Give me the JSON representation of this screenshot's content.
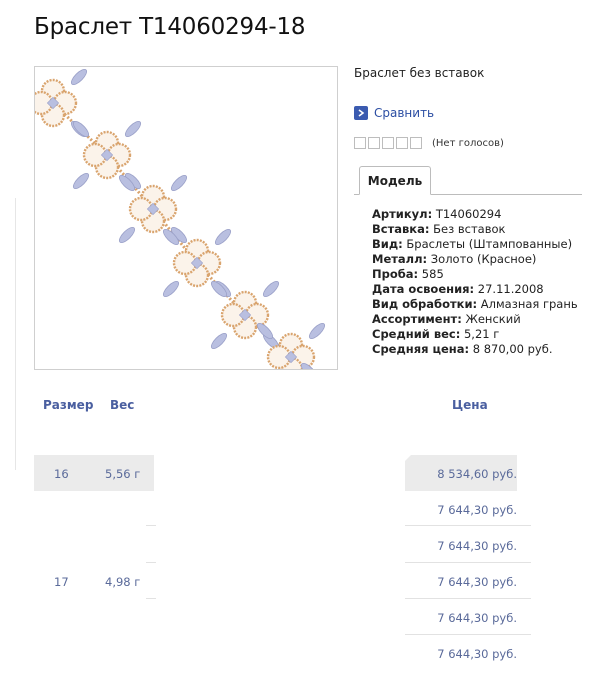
{
  "product": {
    "title": "Браслет Т14060294-18",
    "subtitle": "Браслет без вставок",
    "compare_label": "Сравнить",
    "votes_label": "(Нет голосов)",
    "rating_value": 0,
    "rating_max": 5,
    "tab_model_label": "Модель"
  },
  "specs": [
    {
      "label": "Артикул:",
      "value": " Т14060294"
    },
    {
      "label": "Вставка:",
      "value": " Без вставок"
    },
    {
      "label": "Вид:",
      "value": " Браслеты (Штампованные)"
    },
    {
      "label": "Металл:",
      "value": " Золото (Красное)"
    },
    {
      "label": "Проба:",
      "value": " 585"
    },
    {
      "label": "Дата освоения:",
      "value": " 27.11.2008"
    },
    {
      "label": "Вид обработки:",
      "value": " Алмазная грань"
    },
    {
      "label": "Ассортимент:",
      "value": " Женский"
    },
    {
      "label": "Средний вес:",
      "value": " 5,21 г"
    },
    {
      "label": "Средняя цена:",
      "value": " 8 870,00 руб."
    }
  ],
  "table": {
    "headers": {
      "size": "Размер",
      "weight": "Вес",
      "price": "Цена"
    },
    "groups": [
      {
        "size": "16",
        "weight": "5,56 г"
      },
      {
        "size": "17",
        "weight": "4,98 г"
      }
    ],
    "prices": [
      "8 534,60 руб.",
      "7 644,30 руб.",
      "7 644,30 руб.",
      "7 644,30 руб.",
      "7 644,30 руб.",
      "7 644,30 руб."
    ]
  },
  "colors": {
    "accent": "#2c4ea3",
    "header_text": "#4a5fa0",
    "cell_text": "#5a6a9a",
    "highlight_row": "#ebebeb",
    "gold": "#d9a46e",
    "silver": "#b9bfe0"
  }
}
